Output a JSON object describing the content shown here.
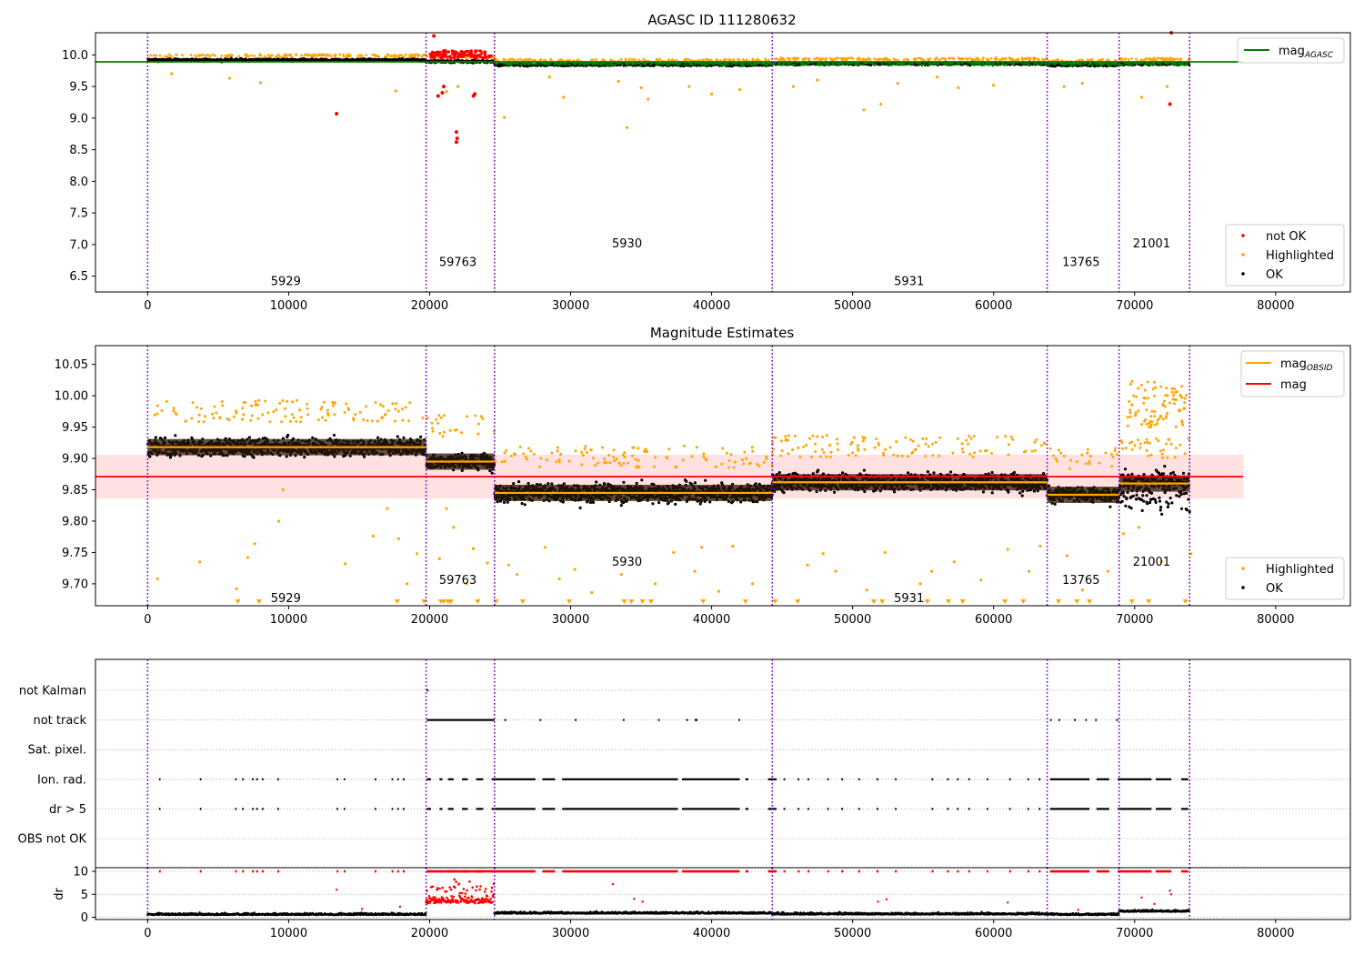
{
  "chart_data": [
    {
      "type": "scatter",
      "title": "AGASC ID 111280632",
      "xlim": [
        -3700,
        85300
      ],
      "ylim": [
        6.25,
        10.35
      ],
      "yticks": [
        6.5,
        7.0,
        7.5,
        8.0,
        8.5,
        9.0,
        9.5,
        10.0
      ],
      "ytick_labels": [
        "6.5",
        "7.0",
        "7.5",
        "8.0",
        "8.5",
        "9.0",
        "9.5",
        "10.0"
      ],
      "xticks": [
        0,
        10000,
        20000,
        30000,
        40000,
        50000,
        60000,
        70000,
        80000
      ],
      "xtick_labels": [
        "0",
        "10000",
        "20000",
        "30000",
        "40000",
        "50000",
        "60000",
        "70000",
        "80000"
      ],
      "boundaries": [
        0,
        19750,
        24600,
        44300,
        63800,
        68900,
        73900
      ],
      "segments": [
        {
          "obsid": "5929",
          "start": 0,
          "end": 19750,
          "mean": 9.918,
          "label_x": 9800,
          "label_y": 6.43
        },
        {
          "obsid": "59763",
          "start": 19750,
          "end": 24600,
          "mean": 9.895,
          "label_x": 22000,
          "label_y": 6.73
        },
        {
          "obsid": "5930",
          "start": 24600,
          "end": 44300,
          "mean": 9.845,
          "label_x": 34000,
          "label_y": 7.03
        },
        {
          "obsid": "5931",
          "start": 44300,
          "end": 63800,
          "mean": 9.862,
          "label_x": 54000,
          "label_y": 6.43
        },
        {
          "obsid": "13765",
          "start": 63800,
          "end": 68900,
          "mean": 9.842,
          "label_x": 66200,
          "label_y": 6.73
        },
        {
          "obsid": "21001",
          "start": 68900,
          "end": 73900,
          "mean": 9.86,
          "label_x": 71200,
          "label_y": 7.03
        }
      ],
      "mag_agasc": {
        "value": 9.89,
        "x_range": [
          -3700,
          77700
        ]
      },
      "not_ok_points": [
        [
          13400,
          9.07
        ],
        [
          20300,
          10.3
        ],
        [
          20600,
          9.35
        ],
        [
          20900,
          9.4
        ],
        [
          21000,
          9.5
        ],
        [
          21900,
          8.78
        ],
        [
          21900,
          8.62
        ],
        [
          21950,
          8.68
        ],
        [
          22400,
          9.98
        ],
        [
          23100,
          9.35
        ],
        [
          23200,
          9.38
        ],
        [
          72500,
          9.22
        ],
        [
          72600,
          10.35
        ]
      ],
      "highlighted_outliers": [
        [
          1700,
          9.7
        ],
        [
          5800,
          9.63
        ],
        [
          8000,
          9.56
        ],
        [
          17600,
          9.43
        ],
        [
          21200,
          9.42
        ],
        [
          22000,
          9.5
        ],
        [
          25300,
          9.01
        ],
        [
          28500,
          9.65
        ],
        [
          29500,
          9.33
        ],
        [
          33400,
          9.58
        ],
        [
          34000,
          8.85
        ],
        [
          35000,
          9.48
        ],
        [
          35500,
          9.3
        ],
        [
          38400,
          9.5
        ],
        [
          40000,
          9.38
        ],
        [
          42000,
          9.45
        ],
        [
          45800,
          9.5
        ],
        [
          47500,
          9.6
        ],
        [
          50800,
          9.13
        ],
        [
          52000,
          9.22
        ],
        [
          53200,
          9.55
        ],
        [
          56000,
          9.65
        ],
        [
          57500,
          9.48
        ],
        [
          60000,
          9.52
        ],
        [
          65000,
          9.5
        ],
        [
          66300,
          9.55
        ],
        [
          70500,
          9.33
        ],
        [
          72300,
          9.5
        ]
      ],
      "legend": {
        "upper": {
          "placement": "upper-right",
          "entries": [
            {
              "label": "mag",
              "subscript": "AGASC",
              "color": "#008000"
            }
          ]
        },
        "lower": {
          "placement": "lower-right",
          "entries": [
            {
              "label": "not OK",
              "color": "#ff0000"
            },
            {
              "label": "Highlighted",
              "color": "#ffa500"
            },
            {
              "label": "OK",
              "color": "#000000"
            }
          ]
        }
      }
    },
    {
      "type": "scatter",
      "title": "Magnitude Estimates",
      "xlim": [
        -3700,
        85300
      ],
      "ylim": [
        9.665,
        10.08
      ],
      "yticks": [
        9.7,
        9.75,
        9.8,
        9.85,
        9.9,
        9.95,
        10.0,
        10.05
      ],
      "ytick_labels": [
        "9.70",
        "9.75",
        "9.80",
        "9.85",
        "9.90",
        "9.95",
        "10.00",
        "10.05"
      ],
      "xticks": [
        0,
        10000,
        20000,
        30000,
        40000,
        50000,
        60000,
        70000,
        80000
      ],
      "xtick_labels": [
        "0",
        "10000",
        "20000",
        "30000",
        "40000",
        "50000",
        "60000",
        "70000",
        "80000"
      ],
      "mag": {
        "value": 9.871,
        "band": [
          9.836,
          9.906
        ],
        "x_range": [
          -3700,
          77700
        ]
      },
      "segment_labels": [
        {
          "text": "5929",
          "x": 9800,
          "y": 9.678
        },
        {
          "text": "59763",
          "x": 22000,
          "y": 9.707
        },
        {
          "text": "5930",
          "x": 34000,
          "y": 9.736
        },
        {
          "text": "5931",
          "x": 54000,
          "y": 9.678
        },
        {
          "text": "13765",
          "x": 66200,
          "y": 9.707
        },
        {
          "text": "21001",
          "x": 71200,
          "y": 9.736
        }
      ],
      "lower_outliers": [
        [
          700,
          9.708
        ],
        [
          3700,
          9.735
        ],
        [
          6300,
          9.692
        ],
        [
          7100,
          9.742
        ],
        [
          7600,
          9.764
        ],
        [
          9300,
          9.8
        ],
        [
          9600,
          9.85
        ],
        [
          14000,
          9.732
        ],
        [
          16000,
          9.776
        ],
        [
          17000,
          9.82
        ],
        [
          17800,
          9.772
        ],
        [
          18400,
          9.7
        ],
        [
          19100,
          9.748
        ],
        [
          20700,
          9.74
        ],
        [
          21200,
          9.82
        ],
        [
          21700,
          9.79
        ],
        [
          22600,
          9.7
        ],
        [
          23100,
          9.756
        ],
        [
          24100,
          9.733
        ],
        [
          25600,
          9.73
        ],
        [
          26200,
          9.715
        ],
        [
          28200,
          9.758
        ],
        [
          29200,
          9.708
        ],
        [
          30300,
          9.723
        ],
        [
          31500,
          9.686
        ],
        [
          33600,
          9.715
        ],
        [
          36000,
          9.7
        ],
        [
          37300,
          9.75
        ],
        [
          38800,
          9.72
        ],
        [
          39300,
          9.758
        ],
        [
          40500,
          9.688
        ],
        [
          41500,
          9.76
        ],
        [
          42900,
          9.7
        ],
        [
          46800,
          9.73
        ],
        [
          47900,
          9.748
        ],
        [
          48800,
          9.72
        ],
        [
          51000,
          9.69
        ],
        [
          52300,
          9.75
        ],
        [
          54800,
          9.7
        ],
        [
          55600,
          9.72
        ],
        [
          57200,
          9.735
        ],
        [
          59100,
          9.706
        ],
        [
          61000,
          9.755
        ],
        [
          62500,
          9.72
        ],
        [
          63300,
          9.76
        ],
        [
          65200,
          9.745
        ],
        [
          66300,
          9.69
        ],
        [
          68100,
          9.72
        ],
        [
          69200,
          9.78
        ],
        [
          70300,
          9.79
        ],
        [
          71900,
          9.735
        ],
        [
          74000,
          9.748
        ]
      ],
      "clipped_markers_x": [
        6400,
        7900,
        17700,
        19600,
        20800,
        21000,
        21300,
        21500,
        23400,
        24700,
        26600,
        29900,
        33800,
        34300,
        35100,
        35700,
        39400,
        42400,
        44500,
        46100,
        51500,
        52100,
        55300,
        56800,
        57800,
        60800,
        62100,
        64600,
        65900,
        66800,
        69800,
        71000,
        73600
      ],
      "legend": {
        "upper": {
          "placement": "upper-right",
          "entries": [
            {
              "label": "mag",
              "subscript": "OBSID",
              "color": "#ffa500"
            },
            {
              "label": "mag",
              "color": "#ff0000"
            }
          ]
        },
        "lower": {
          "placement": "lower-right",
          "entries": [
            {
              "label": "Highlighted",
              "color": "#ffa500"
            },
            {
              "label": "OK",
              "color": "#000000"
            }
          ]
        }
      }
    },
    {
      "type": "scatter",
      "title": "",
      "xlim": [
        -3700,
        85300
      ],
      "flag_rows": [
        "not Kalman",
        "not track",
        "Sat. pixel.",
        "Ion. rad.",
        "dr > 5",
        "OBS not OK"
      ],
      "flag_events": {
        "not Kalman": [
          [
            19800,
            19850
          ]
        ],
        "not track": [
          [
            19800,
            24600
          ],
          [
            25300,
            25400
          ],
          [
            27800,
            27900
          ],
          [
            30300,
            30400
          ],
          [
            33700,
            33800
          ],
          [
            36200,
            36300
          ],
          [
            38200,
            38300
          ],
          [
            38800,
            39000
          ],
          [
            41900,
            42000
          ],
          [
            64000,
            64100
          ],
          [
            64600,
            64700
          ],
          [
            65700,
            65800
          ],
          [
            66500,
            66600
          ],
          [
            67200,
            67300
          ],
          [
            68700,
            68800
          ]
        ],
        "Sat. pixel.": [],
        "Ion. rad.": [
          [
            800,
            900
          ],
          [
            3700,
            3800
          ],
          [
            6200,
            6300
          ],
          [
            6700,
            6800
          ],
          [
            7400,
            7500
          ],
          [
            7700,
            7800
          ],
          [
            8100,
            8200
          ],
          [
            9200,
            9300
          ],
          [
            13400,
            13500
          ],
          [
            13900,
            14000
          ],
          [
            16100,
            16200
          ],
          [
            17300,
            17400
          ],
          [
            17700,
            17800
          ],
          [
            18100,
            18200
          ],
          [
            19800,
            20100
          ],
          [
            20700,
            20900
          ],
          [
            21300,
            21700
          ],
          [
            22300,
            22700
          ],
          [
            23300,
            23800
          ],
          [
            24400,
            27500
          ],
          [
            28000,
            28900
          ],
          [
            29400,
            37600
          ],
          [
            37900,
            42000
          ],
          [
            42400,
            42600
          ],
          [
            44000,
            44600
          ],
          [
            45100,
            45200
          ],
          [
            46100,
            46200
          ],
          [
            46800,
            46900
          ],
          [
            48200,
            48300
          ],
          [
            49200,
            49300
          ],
          [
            50400,
            50500
          ],
          [
            51700,
            51800
          ],
          [
            53000,
            53100
          ],
          [
            55600,
            55700
          ],
          [
            56700,
            56800
          ],
          [
            57400,
            57500
          ],
          [
            58200,
            58300
          ],
          [
            59500,
            59600
          ],
          [
            61100,
            61200
          ],
          [
            62400,
            62500
          ],
          [
            63200,
            63300
          ],
          [
            64000,
            66800
          ],
          [
            67300,
            68200
          ],
          [
            68800,
            71200
          ],
          [
            71500,
            72600
          ],
          [
            73300,
            73800
          ]
        ],
        "dr > 5": [
          [
            800,
            900
          ],
          [
            3700,
            3800
          ],
          [
            6200,
            6300
          ],
          [
            6700,
            6800
          ],
          [
            7400,
            7500
          ],
          [
            7700,
            7800
          ],
          [
            8100,
            8200
          ],
          [
            9200,
            9300
          ],
          [
            13400,
            13500
          ],
          [
            13900,
            14000
          ],
          [
            16100,
            16200
          ],
          [
            17300,
            17400
          ],
          [
            17700,
            17800
          ],
          [
            18100,
            18200
          ],
          [
            19800,
            20100
          ],
          [
            20700,
            20900
          ],
          [
            21300,
            21700
          ],
          [
            22300,
            22700
          ],
          [
            23300,
            23800
          ],
          [
            24400,
            27500
          ],
          [
            28000,
            28900
          ],
          [
            29400,
            37600
          ],
          [
            37900,
            42000
          ],
          [
            42400,
            42600
          ],
          [
            44000,
            44600
          ],
          [
            45100,
            45200
          ],
          [
            46100,
            46200
          ],
          [
            46800,
            46900
          ],
          [
            48200,
            48300
          ],
          [
            49200,
            49300
          ],
          [
            50400,
            50500
          ],
          [
            51700,
            51800
          ],
          [
            53000,
            53100
          ],
          [
            55600,
            55700
          ],
          [
            56700,
            56800
          ],
          [
            57400,
            57500
          ],
          [
            58200,
            58300
          ],
          [
            59500,
            59600
          ],
          [
            61100,
            61200
          ],
          [
            62400,
            62500
          ],
          [
            63200,
            63300
          ],
          [
            64000,
            66800
          ],
          [
            67300,
            68200
          ],
          [
            68800,
            71200
          ],
          [
            71500,
            72600
          ],
          [
            73300,
            73800
          ]
        ],
        "OBS not OK": []
      }
    },
    {
      "type": "scatter",
      "title": "",
      "ylabel": "dr",
      "xlim": [
        -3700,
        85300
      ],
      "ylim": [
        -0.5,
        10.8
      ],
      "yticks": [
        0,
        5,
        10
      ],
      "ytick_labels": [
        "0",
        "5",
        "10"
      ],
      "xticks": [
        0,
        10000,
        20000,
        30000,
        40000,
        50000,
        60000,
        70000,
        80000
      ],
      "xtick_labels": [
        "0",
        "10000",
        "20000",
        "30000",
        "40000",
        "50000",
        "60000",
        "70000",
        "80000"
      ],
      "baseline_segments": [
        {
          "start": 0,
          "end": 19750,
          "level": 0.5
        },
        {
          "start": 19750,
          "end": 24600,
          "level": 3.0,
          "color": "#ff0000"
        },
        {
          "start": 24600,
          "end": 44300,
          "level": 0.8
        },
        {
          "start": 44300,
          "end": 63800,
          "level": 0.6
        },
        {
          "start": 63800,
          "end": 68900,
          "level": 0.5
        },
        {
          "start": 68900,
          "end": 73900,
          "level": 1.2
        }
      ],
      "scattered_points": [
        [
          13400,
          6.0
        ],
        [
          15200,
          1.8
        ],
        [
          17900,
          2.3
        ],
        [
          33000,
          7.2
        ],
        [
          34500,
          4.0
        ],
        [
          35100,
          3.4
        ],
        [
          51800,
          3.4
        ],
        [
          52400,
          3.9
        ],
        [
          61000,
          3.2
        ],
        [
          66000,
          1.6
        ],
        [
          70500,
          4.3
        ],
        [
          71400,
          2.9
        ],
        [
          72500,
          5.8
        ],
        [
          72600,
          5.0
        ]
      ]
    }
  ]
}
